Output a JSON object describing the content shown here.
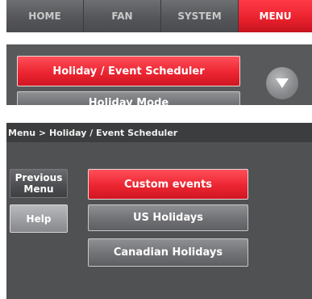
{
  "tabs": [
    {
      "label": "HOME",
      "active": false
    },
    {
      "label": "FAN",
      "active": false
    },
    {
      "label": "SYSTEM",
      "active": false
    },
    {
      "label": "MENU",
      "active": true
    }
  ],
  "panel2": {
    "holiday_event_scheduler_label": "Holiday / Event Scheduler",
    "holiday_mode_label": "Holiday Mode"
  },
  "screen": {
    "breadcrumb": "Menu > Holiday / Event Scheduler",
    "previous_menu_label": "Previous Menu",
    "help_label": "Help",
    "options": [
      {
        "label": "Custom events",
        "selected": true
      },
      {
        "label": "US Holidays",
        "selected": false
      },
      {
        "label": "Canadian Holidays",
        "selected": false
      }
    ]
  },
  "colors": {
    "accent_red": "#e8202c",
    "panel_gray": "#505153",
    "tab_gray": "#55565a"
  }
}
